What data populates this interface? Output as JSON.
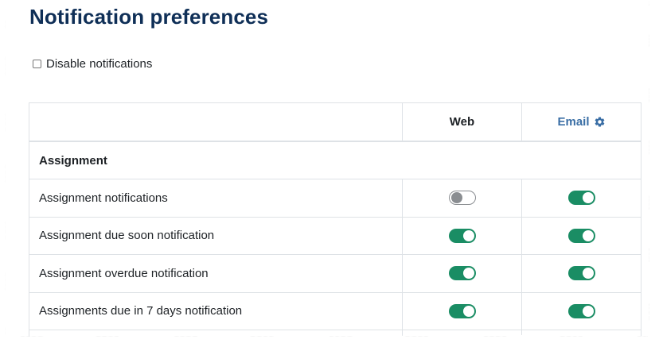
{
  "page": {
    "title": "Notification preferences"
  },
  "disable": {
    "label": "Disable notifications",
    "checked": false
  },
  "table": {
    "columns": {
      "web": "Web",
      "email": "Email",
      "email_icon": "gear-icon"
    },
    "section": "Assignment",
    "rows": [
      {
        "label": "Assignment notifications",
        "web": false,
        "email": true
      },
      {
        "label": "Assignment due soon notification",
        "web": true,
        "email": true
      },
      {
        "label": "Assignment overdue notification",
        "web": true,
        "email": true
      },
      {
        "label": "Assignments due in 7 days notification",
        "web": true,
        "email": true
      }
    ]
  },
  "colors": {
    "title": "#0f2f57",
    "toggle_on": "#1a8d64",
    "toggle_off": "#8a8d91",
    "link": "#3a6ea5"
  }
}
